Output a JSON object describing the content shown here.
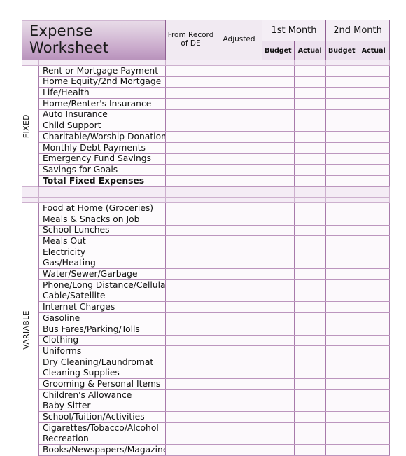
{
  "sheet": {
    "title": "Expense Worksheet",
    "columns": {
      "from_record": "From Record of DE",
      "from_record_line1": "From Record",
      "from_record_line2": "of DE",
      "adjusted": "Adjusted",
      "month1": "1st Month",
      "month2": "2nd Month",
      "budget": "Budget",
      "actual": "Actual"
    },
    "sections": [
      {
        "rail_label": "FIXED",
        "rows": [
          {
            "label": "Rent or Mortgage Payment",
            "bold": false
          },
          {
            "label": "Home Equity/2nd Mortgage",
            "bold": false
          },
          {
            "label": "Life/Health",
            "bold": false
          },
          {
            "label": "Home/Renter's Insurance",
            "bold": false
          },
          {
            "label": "Auto Insurance",
            "bold": false
          },
          {
            "label": "Child Support",
            "bold": false
          },
          {
            "label": "Charitable/Worship Donations",
            "bold": false
          },
          {
            "label": "Monthly Debt Payments",
            "bold": false
          },
          {
            "label": "Emergency Fund Savings",
            "bold": false
          },
          {
            "label": "Savings for Goals",
            "bold": false
          },
          {
            "label": "Total Fixed Expenses",
            "bold": true
          }
        ]
      },
      {
        "rail_label": "VARIABLE",
        "rows": [
          {
            "label": "Food at Home (Groceries)",
            "bold": false
          },
          {
            "label": "Meals & Snacks on Job",
            "bold": false
          },
          {
            "label": "School Lunches",
            "bold": false
          },
          {
            "label": "Meals Out",
            "bold": false
          },
          {
            "label": "Electricity",
            "bold": false
          },
          {
            "label": "Gas/Heating",
            "bold": false
          },
          {
            "label": "Water/Sewer/Garbage",
            "bold": false
          },
          {
            "label": "Phone/Long Distance/Cellular",
            "bold": false
          },
          {
            "label": "Cable/Satellite",
            "bold": false
          },
          {
            "label": "Internet Charges",
            "bold": false
          },
          {
            "label": "Gasoline",
            "bold": false
          },
          {
            "label": "Bus Fares/Parking/Tolls",
            "bold": false
          },
          {
            "label": "Clothing",
            "bold": false
          },
          {
            "label": "Uniforms",
            "bold": false
          },
          {
            "label": "Dry Cleaning/Laundromat",
            "bold": false
          },
          {
            "label": "Cleaning Supplies",
            "bold": false
          },
          {
            "label": "Grooming & Personal Items",
            "bold": false
          },
          {
            "label": "Children's Allowance",
            "bold": false
          },
          {
            "label": "Baby Sitter",
            "bold": false
          },
          {
            "label": "School/Tuition/Activities",
            "bold": false
          },
          {
            "label": "Cigarettes/Tobacco/Alcohol",
            "bold": false
          },
          {
            "label": "Recreation",
            "bold": false
          },
          {
            "label": "Books/Newspapers/Magazines",
            "bold": false
          }
        ]
      }
    ],
    "colors": {
      "title_gradient_top": "#e8dbe8",
      "title_gradient_bottom": "#b892bb",
      "border": "#8f5f92",
      "grid_line": "#a87bab",
      "separator_fill": "#f4ecf5",
      "cell_fill": "#fcf9fc"
    }
  }
}
